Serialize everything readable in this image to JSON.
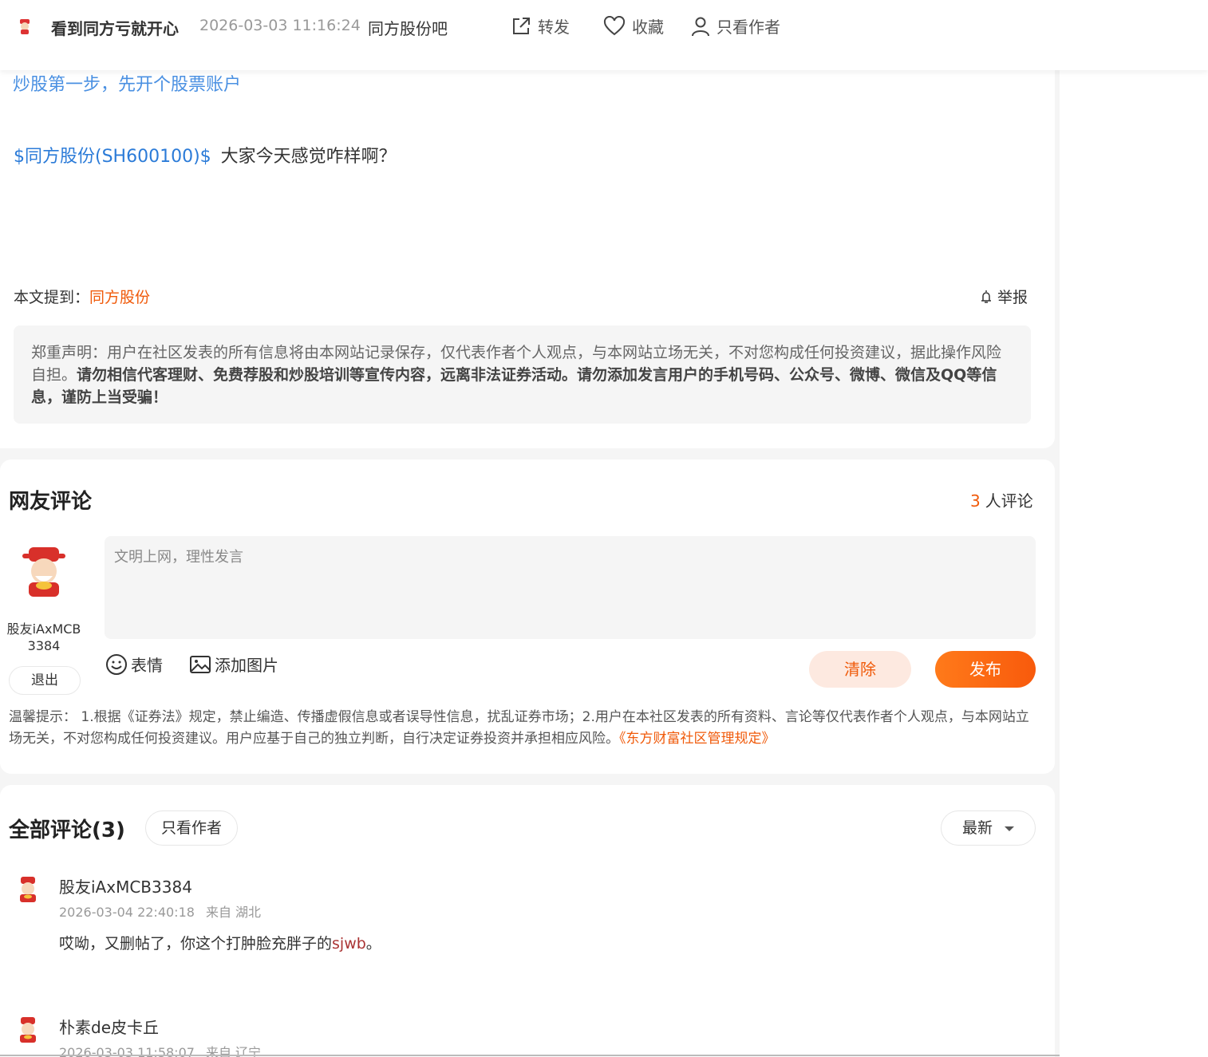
{
  "header": {
    "author": "看到同方亏就开心",
    "post_time": "2026-03-03 11:16:24",
    "bar_name": "同方股份吧",
    "share_label": "转发",
    "favorite_label": "收藏",
    "author_only_label": "只看作者"
  },
  "article": {
    "ad_link": "炒股第一步，先开个股票账户",
    "stock_tag": "$同方股份(SH600100)$",
    "body_text": "大家今天感觉咋样啊？",
    "mention_label": "本文提到：",
    "mention_stock": "同方股份",
    "report_label": "举报",
    "disclaimer_plain": "郑重声明：用户在社区发表的所有信息将由本网站记录保存，仅代表作者个人观点，与本网站立场无关，不对您构成任何投资建议，据此操作风险自担。",
    "disclaimer_bold": "请勿相信代客理财、免费荐股和炒股培训等宣传内容，远离非法证券活动。请勿添加发言用户的手机号码、公众号、微博、微信及QQ等信息，谨防上当受骗！"
  },
  "comment_form": {
    "title": "网友评论",
    "count": "3",
    "count_suffix": "人评论",
    "user_name": "股友iAxMCB3384",
    "logout_label": "退出",
    "placeholder": "文明上网，理性发言",
    "emoji_label": "表情",
    "image_label": "添加图片",
    "clear_label": "清除",
    "post_label": "发布",
    "tips_text": "温馨提示： 1.根据《证券法》规定，禁止编造、传播虚假信息或者误导性信息，扰乱证券市场；2.用户在本社区发表的所有资料、言论等仅代表作者个人观点，与本网站立场无关，不对您构成任何投资建议。用户应基于自己的独立判断，自行决定证券投资并承担相应风险。",
    "rules_link": "《东方财富社区管理规定》"
  },
  "comments": {
    "title": "全部评论(3)",
    "author_only_chip": "只看作者",
    "sort_label": "最新",
    "items": [
      {
        "name": "股友iAxMCB3384",
        "time": "2026-03-04 22:40:18",
        "location": "来自 湖北",
        "text": "哎呦，又删帖了，你这个打肿脸充胖子的",
        "scribble": "sjwb",
        "text_end": "。"
      },
      {
        "name": "朴素de皮卡丘",
        "time": "2026-03-03 11:58:07",
        "location": "来自 辽宁"
      }
    ]
  },
  "colors": {
    "accent": "#f05a0a",
    "link_blue": "#2b7bd8",
    "ad_blue": "#4a90e2"
  }
}
